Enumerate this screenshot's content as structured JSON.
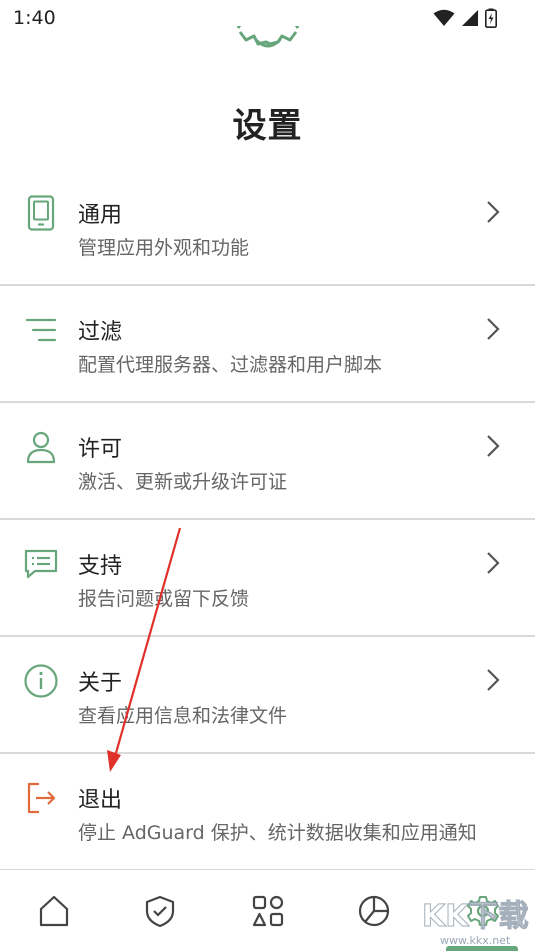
{
  "status_bar": {
    "time": "1:40"
  },
  "page": {
    "title": "设置"
  },
  "settings": [
    {
      "title": "通用",
      "subtitle": "管理应用外观和功能",
      "icon": "phone-icon"
    },
    {
      "title": "过滤",
      "subtitle": "配置代理服务器、过滤器和用户脚本",
      "icon": "filter-icon"
    },
    {
      "title": "许可",
      "subtitle": "激活、更新或升级许可证",
      "icon": "user-icon"
    },
    {
      "title": "支持",
      "subtitle": "报告问题或留下反馈",
      "icon": "chat-icon"
    },
    {
      "title": "关于",
      "subtitle": "查看应用信息和法律文件",
      "icon": "info-icon"
    },
    {
      "title": "退出",
      "subtitle": "停止 AdGuard 保护、统计数据收集和应用通知",
      "icon": "exit-icon"
    }
  ],
  "bottom_nav": [
    "home-icon",
    "shield-icon",
    "apps-icon",
    "stats-icon",
    "settings-icon"
  ],
  "watermark": {
    "text": "KK下载",
    "url": "www.kkx.net"
  },
  "colors": {
    "accent": "#67a67a",
    "exit": "#e06a3b",
    "arrow": "#e0302a"
  }
}
